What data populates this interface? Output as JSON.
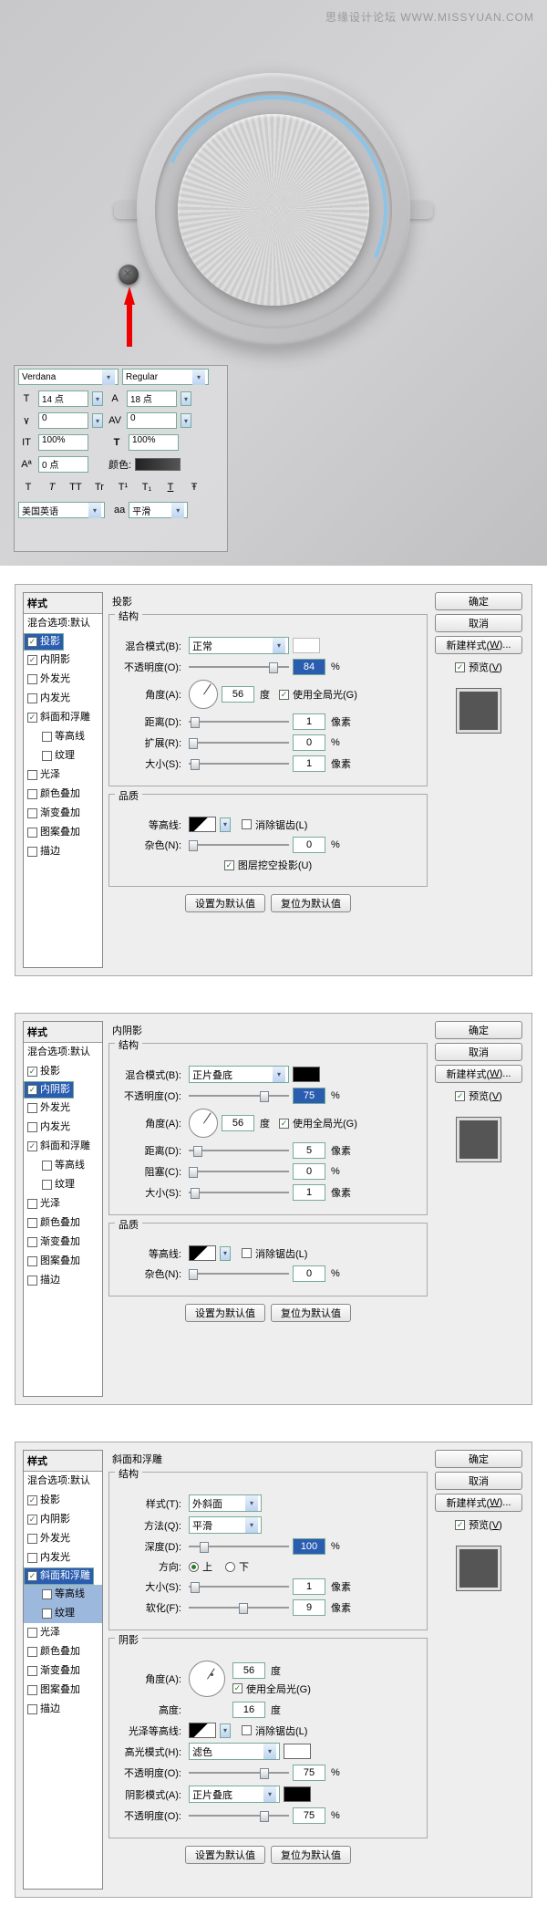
{
  "watermark": "思缘设计论坛  WWW.MISSYUAN.COM",
  "char_panel": {
    "font_family": "Verdana",
    "font_style": "Regular",
    "size_label": "14 点",
    "leading_label": "18 点",
    "tracking": "0",
    "kerning": "0",
    "vscale": "100%",
    "hscale": "100%",
    "baseline": "0 点",
    "color_label": "颜色:",
    "lang": "美国英语",
    "aa": "平滑"
  },
  "styles_list": {
    "header": "样式",
    "blend_defaults": "混合选项:默认",
    "drop_shadow": "投影",
    "inner_shadow": "内阴影",
    "outer_glow": "外发光",
    "inner_glow": "内发光",
    "bevel_emboss": "斜面和浮雕",
    "contour": "等高线",
    "texture": "纹理",
    "satin": "光泽",
    "color_overlay": "颜色叠加",
    "gradient_overlay": "渐变叠加",
    "pattern_overlay": "图案叠加",
    "stroke": "描边"
  },
  "buttons": {
    "ok": "确定",
    "cancel": "取消",
    "new_style": "新建样式(W)...",
    "preview": "预览(V)",
    "make_default": "设置为默认值",
    "reset_default": "复位为默认值"
  },
  "labels": {
    "structure": "结构",
    "quality": "品质",
    "shading": "阴影",
    "blend_mode": "混合模式(B):",
    "opacity": "不透明度(O):",
    "angle": "角度(A):",
    "degree": "度",
    "use_global": "使用全局光(G)",
    "distance": "距离(D):",
    "spread": "扩展(R):",
    "choke": "阻塞(C):",
    "size": "大小(S):",
    "px": "像素",
    "pct": "%",
    "contour_lbl": "等高线:",
    "anti_alias": "消除锯齿(L)",
    "noise": "杂色(N):",
    "knockout": "图层挖空投影(U)",
    "style_lbl": "样式(T):",
    "technique": "方法(Q):",
    "depth": "深度(D):",
    "direction": "方向:",
    "up": "上",
    "down": "下",
    "soften": "软化(F):",
    "altitude": "高度:",
    "gloss_contour": "光泽等高线:",
    "highlight_mode": "高光模式(H):",
    "shadow_mode": "阴影模式(A):"
  },
  "panel1": {
    "title": "投影",
    "blend_mode": "正常",
    "opacity": "84",
    "angle": "56",
    "distance": "1",
    "spread": "0",
    "size": "1",
    "noise": "0"
  },
  "panel2": {
    "title": "内阴影",
    "blend_mode": "正片叠底",
    "opacity": "75",
    "angle": "56",
    "distance": "5",
    "choke": "0",
    "size": "1",
    "noise": "0"
  },
  "panel3": {
    "title": "斜面和浮雕",
    "style": "外斜面",
    "technique": "平滑",
    "depth": "100",
    "size": "1",
    "soften": "9",
    "angle": "56",
    "altitude": "16",
    "highlight_mode": "滤色",
    "highlight_opacity": "75",
    "shadow_mode": "正片叠底",
    "shadow_opacity": "75"
  }
}
